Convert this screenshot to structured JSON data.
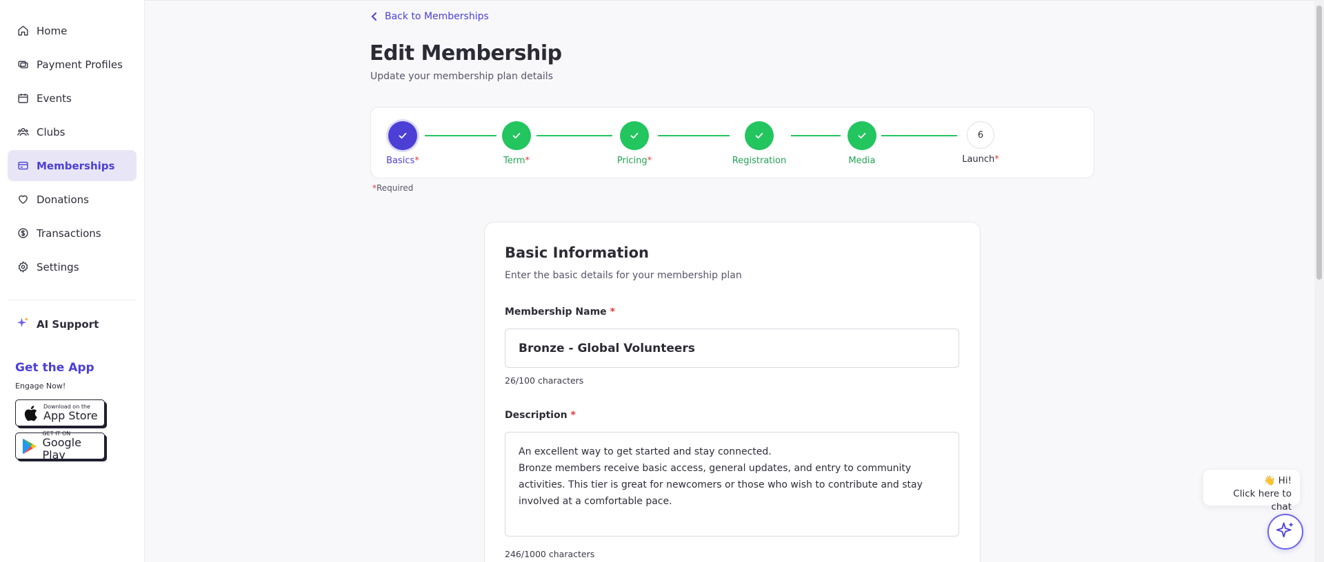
{
  "sidebar": {
    "items": [
      {
        "label": "Home",
        "icon": "home-icon"
      },
      {
        "label": "Payment Profiles",
        "icon": "payment-icon"
      },
      {
        "label": "Events",
        "icon": "calendar-icon"
      },
      {
        "label": "Clubs",
        "icon": "users-icon"
      },
      {
        "label": "Memberships",
        "icon": "card-icon",
        "active": true
      },
      {
        "label": "Donations",
        "icon": "heart-icon"
      },
      {
        "label": "Transactions",
        "icon": "dollar-icon"
      },
      {
        "label": "Settings",
        "icon": "gear-icon"
      }
    ],
    "ai_support": "AI Support",
    "get_app_title": "Get the App",
    "get_app_sub": "Engage Now!",
    "app_store_small": "Download on the",
    "app_store_big": "App Store",
    "google_play_small": "GET IT ON",
    "google_play_big": "Google Play"
  },
  "header": {
    "back_label": "Back to Memberships",
    "title": "Edit Membership",
    "subtitle": "Update your membership plan details"
  },
  "stepper": {
    "steps": [
      {
        "label": "Basics",
        "required": "*",
        "state": "current"
      },
      {
        "label": "Term",
        "required": "*",
        "state": "done"
      },
      {
        "label": "Pricing",
        "required": "*",
        "state": "done"
      },
      {
        "label": "Registration",
        "required": "",
        "state": "done"
      },
      {
        "label": "Media",
        "required": "",
        "state": "done"
      },
      {
        "label": "Launch",
        "required": "*",
        "state": "todo",
        "number": "6"
      }
    ],
    "required_star": "*",
    "required_note": "Required"
  },
  "form": {
    "title": "Basic Information",
    "subtitle": "Enter the basic details for your membership plan",
    "name_label": "Membership Name",
    "name_value": "Bronze - Global Volunteers",
    "name_counter": "26/100 characters",
    "description_label": "Description",
    "description_line1": "An excellent way to get started and stay connected.",
    "description_line2": "Bronze members receive basic access, general updates, and entry to community",
    "description_line3": "activities. This tier is great for newcomers or those who wish to contribute and stay",
    "description_line4": "involved at a comfortable pace.",
    "description_counter": "246/1000 characters",
    "required_star": "*"
  },
  "chat": {
    "emoji": "👋",
    "greeting": "Hi!",
    "prompt": "Click here to chat"
  },
  "colors": {
    "accent": "#4b3fd6",
    "success": "#22c55e",
    "required": "#e53935"
  }
}
